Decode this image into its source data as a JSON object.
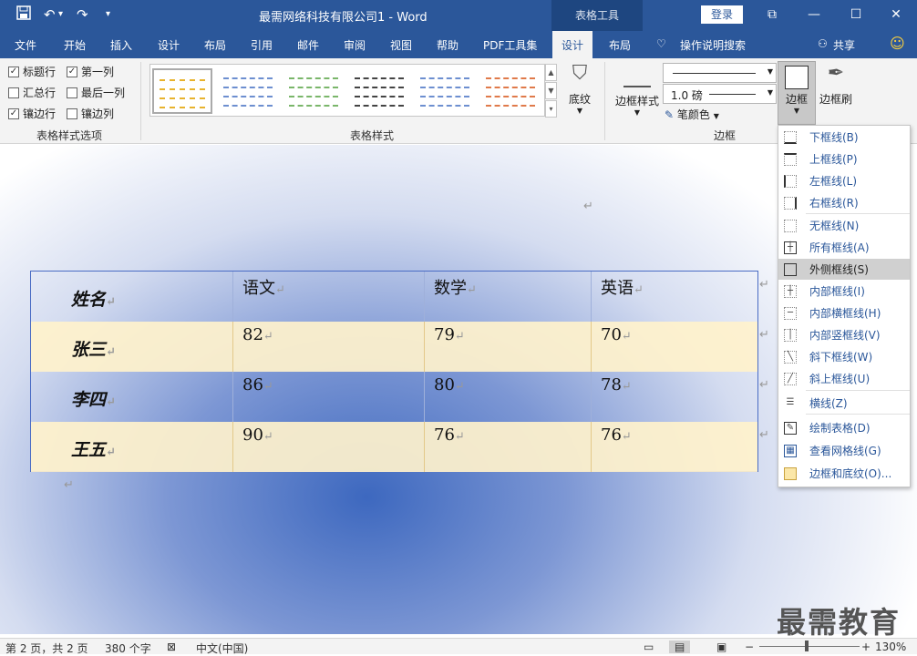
{
  "titlebar": {
    "title": "最需网络科技有限公司1 - Word",
    "tool_tab": "表格工具",
    "login": "登录",
    "icons": [
      "save-icon",
      "undo-icon",
      "redo-icon",
      "customize-icon"
    ]
  },
  "tabs": [
    "文件",
    "开始",
    "插入",
    "设计",
    "布局",
    "引用",
    "邮件",
    "审阅",
    "视图",
    "帮助",
    "PDF工具集",
    "设计",
    "布局"
  ],
  "active_tab": "设计",
  "tell_me": "操作说明搜索",
  "share": "共享",
  "style_options": {
    "items": [
      {
        "label": "标题行",
        "checked": true
      },
      {
        "label": "第一列",
        "checked": true
      },
      {
        "label": "汇总行",
        "checked": false
      },
      {
        "label": "最后一列",
        "checked": false
      },
      {
        "label": "镶边行",
        "checked": true
      },
      {
        "label": "镶边列",
        "checked": false
      }
    ],
    "group_label": "表格样式选项"
  },
  "styles_group": {
    "label": "表格样式",
    "colors": [
      "#e8b32e",
      "#6d8fd0",
      "#7ab66a",
      "#444444",
      "#6d8fd0",
      "#e07a4a"
    ]
  },
  "shading": "底纹",
  "borders": {
    "border_styles": "边框样式",
    "weight": "1.0 磅",
    "pen_color": "笔颜色",
    "group_label": "边框",
    "borders_button": "边框",
    "painter_button": "边框刷"
  },
  "table": {
    "header": [
      "姓名",
      "语文",
      "数学",
      "英语"
    ],
    "rows": [
      [
        "张三",
        "82",
        "79",
        "70"
      ],
      [
        "李四",
        "86",
        "80",
        "78"
      ],
      [
        "王五",
        "90",
        "76",
        "76"
      ]
    ]
  },
  "menu": [
    {
      "label": "下框线(B)",
      "icon": "bottom-border-icon"
    },
    {
      "label": "上框线(P)",
      "icon": "top-border-icon"
    },
    {
      "label": "左框线(L)",
      "icon": "left-border-icon"
    },
    {
      "label": "右框线(R)",
      "icon": "right-border-icon"
    },
    {
      "label": "无框线(N)",
      "icon": "no-border-icon"
    },
    {
      "label": "所有框线(A)",
      "icon": "all-borders-icon"
    },
    {
      "label": "外侧框线(S)",
      "icon": "outside-borders-icon",
      "highlighted": true
    },
    {
      "label": "内部框线(I)",
      "icon": "inside-borders-icon"
    },
    {
      "label": "内部横框线(H)",
      "icon": "inside-horizontal-border-icon"
    },
    {
      "label": "内部竖框线(V)",
      "icon": "inside-vertical-border-icon"
    },
    {
      "label": "斜下框线(W)",
      "icon": "diagonal-down-border-icon"
    },
    {
      "label": "斜上框线(U)",
      "icon": "diagonal-up-border-icon"
    },
    {
      "label": "横线(Z)",
      "icon": "horizontal-line-icon"
    },
    {
      "label": "绘制表格(D)",
      "icon": "draw-table-icon"
    },
    {
      "label": "查看网格线(G)",
      "icon": "view-gridlines-icon"
    },
    {
      "label": "边框和底纹(O)...",
      "icon": "borders-shading-icon"
    }
  ],
  "status": {
    "page": "第 2 页，共 2 页",
    "words": "380 个字",
    "lang": "中文(中国)",
    "zoom": "130%"
  },
  "watermark": "最需教育"
}
